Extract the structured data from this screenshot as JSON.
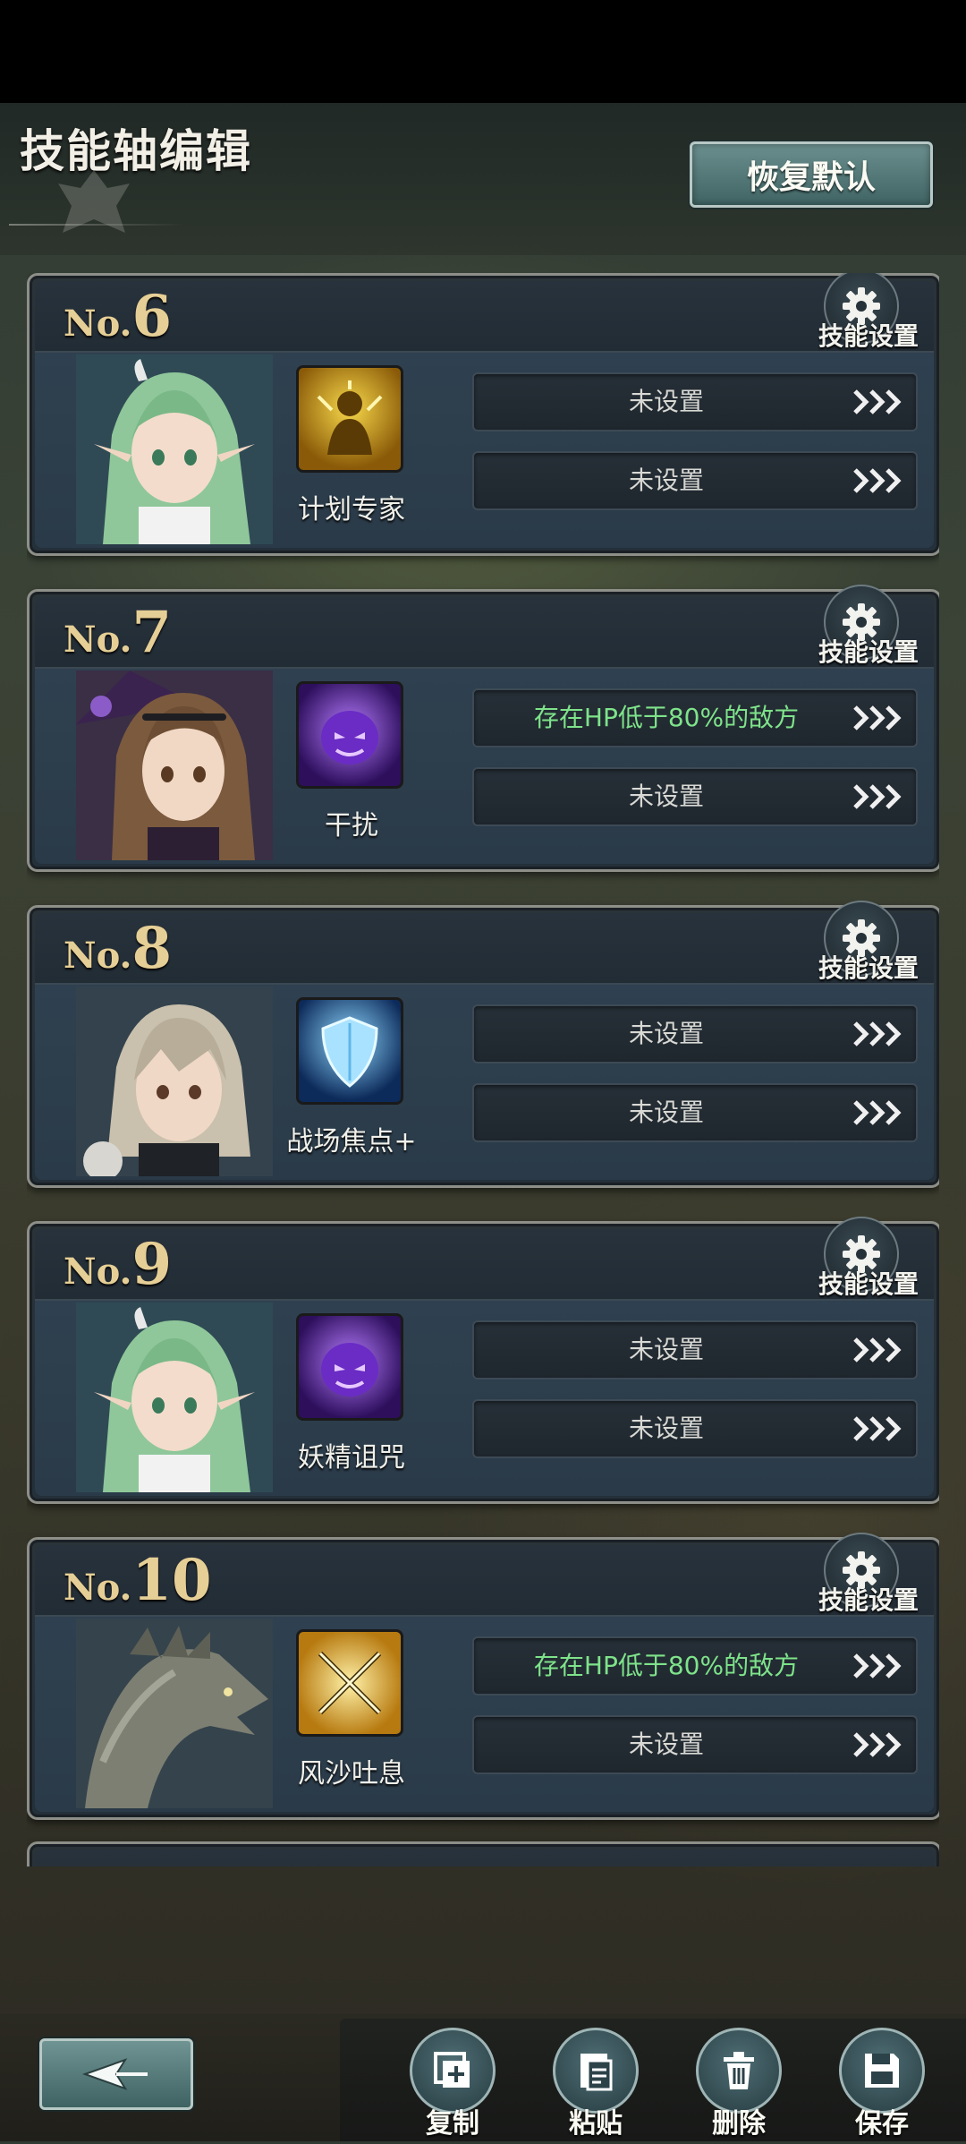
{
  "header": {
    "title": "技能轴编辑",
    "restore_label": "恢复默认"
  },
  "gear_label": "技能设置",
  "cards": [
    {
      "no_prefix": "No.",
      "no": "6",
      "skill": "计划专家",
      "conditions": [
        "未设置",
        "未设置"
      ],
      "portrait": "green-haired-elf"
    },
    {
      "no_prefix": "No.",
      "no": "7",
      "skill": "干扰",
      "conditions": [
        "存在HP低于80%的敌方",
        "未设置"
      ],
      "portrait": "brown-haired-witch"
    },
    {
      "no_prefix": "No.",
      "no": "8",
      "skill": "战场焦点+",
      "conditions": [
        "未设置",
        "未设置"
      ],
      "portrait": "silver-haired-girl"
    },
    {
      "no_prefix": "No.",
      "no": "9",
      "skill": "妖精诅咒",
      "conditions": [
        "未设置",
        "未设置"
      ],
      "portrait": "green-haired-elf"
    },
    {
      "no_prefix": "No.",
      "no": "10",
      "skill": "风沙吐息",
      "conditions": [
        "存在HP低于80%的敌方",
        "未设置"
      ],
      "portrait": "stone-dragon"
    }
  ],
  "actions": {
    "copy": "复制",
    "paste": "粘贴",
    "delete": "删除",
    "save": "保存"
  },
  "colors": {
    "condition_set": "#7ee38a",
    "condition_unset": "#d8d8d4",
    "number_gold": "#e6cf96"
  }
}
